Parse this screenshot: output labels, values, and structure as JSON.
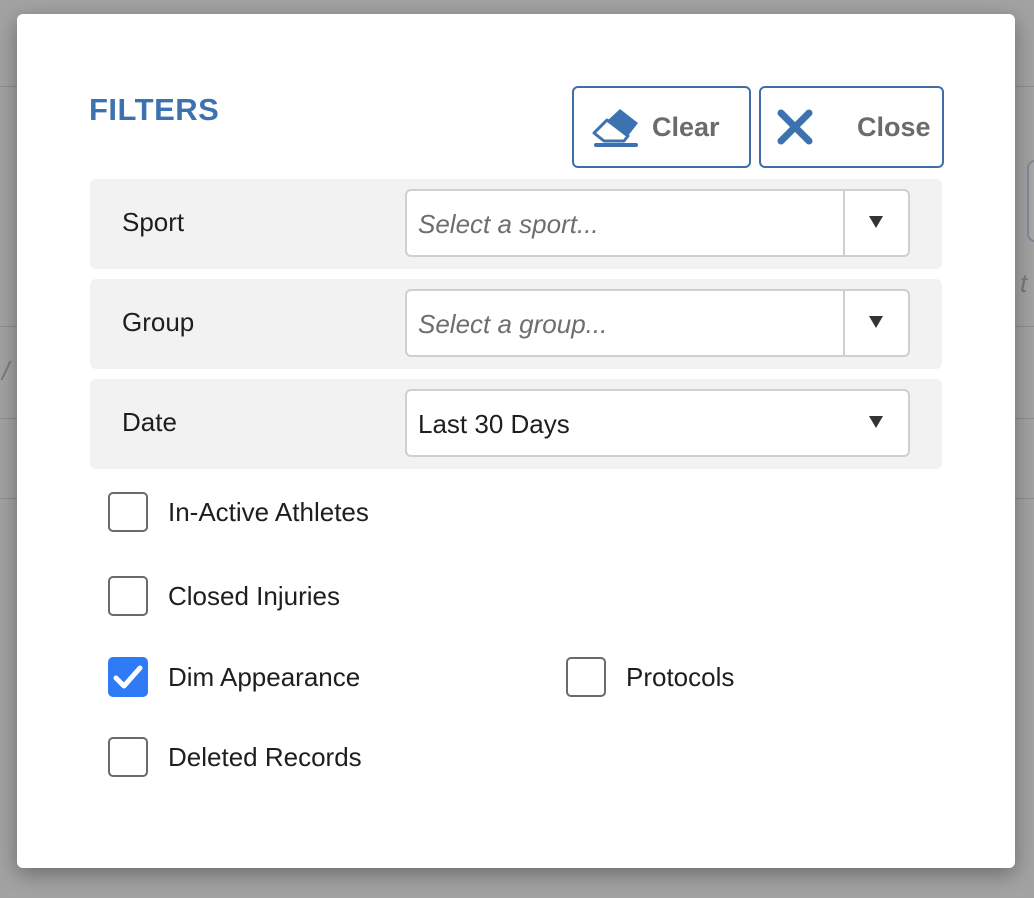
{
  "modal": {
    "title": "FILTERS",
    "clear_button": {
      "label": "Clear",
      "icon": "eraser-icon"
    },
    "close_button": {
      "label": "Close",
      "icon": "close-icon"
    }
  },
  "filters": {
    "sport": {
      "label": "Sport",
      "placeholder": "Select a sport..."
    },
    "group": {
      "label": "Group",
      "placeholder": "Select a group..."
    },
    "date": {
      "label": "Date",
      "value": "Last 30 Days"
    }
  },
  "checkboxes": {
    "inactive_athletes": {
      "label": "In-Active Athletes",
      "checked": false
    },
    "closed_injuries": {
      "label": "Closed Injuries",
      "checked": false
    },
    "dim_appearance": {
      "label": "Dim Appearance",
      "checked": true
    },
    "protocols": {
      "label": "Protocols",
      "checked": false
    },
    "deleted_records": {
      "label": "Deleted Records",
      "checked": false
    }
  },
  "background": {
    "glyph_left": "/",
    "glyph_right": "t"
  },
  "colors": {
    "accent": "#3d72b0",
    "checkbox_checked": "#2f7bf5"
  }
}
